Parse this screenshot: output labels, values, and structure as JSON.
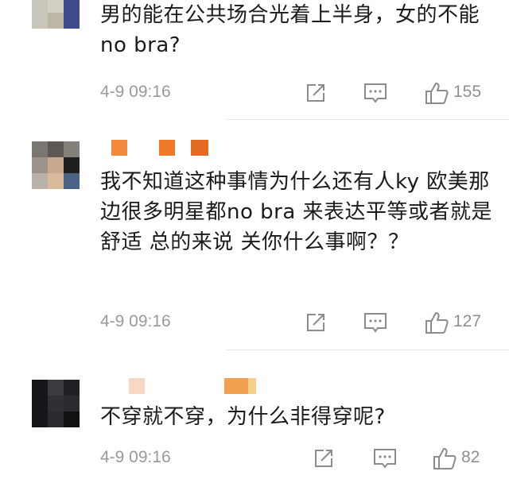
{
  "comments": [
    {
      "text": "男的能在公共场合光着上半身，女的不能no bra?",
      "time": "4-9 09:16",
      "likes": "155",
      "icons": [
        "share-icon",
        "comment-icon",
        "thumbs-up-icon"
      ]
    },
    {
      "text": "我不知道这种事情为什么还有人ky 欧美那边很多明星都no bra 来表达平等或者就是舒适 总的来说 关你什么事啊？？",
      "time": "4-9 09:16",
      "likes": "127",
      "icons": [
        "share-icon",
        "comment-icon",
        "thumbs-up-icon"
      ]
    },
    {
      "text": "不穿就不穿，为什么非得穿呢?",
      "time": "4-9 09:16",
      "likes": "82",
      "icons": [
        "share-icon",
        "comment-icon",
        "thumbs-up-icon"
      ]
    }
  ],
  "colors": {
    "meta_gray": "#9a9a9a",
    "divider": "#e6e6e6",
    "name_pixel_orange": "#f08a3c"
  }
}
